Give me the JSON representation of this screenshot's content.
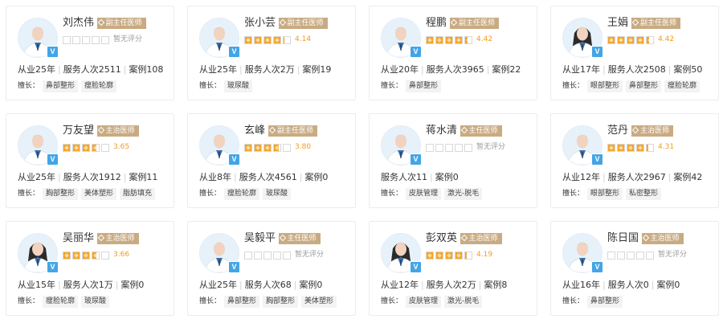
{
  "labels": {
    "verified": "V",
    "specialty_prefix": "擅长：",
    "no_rating": "暂无评分"
  },
  "doctors": [
    {
      "name": "刘杰伟",
      "title": "副主任医师",
      "rating": 0,
      "rating_text": "暂无评分",
      "years": "从业25年",
      "served": "服务人次2511",
      "cases": "案例108",
      "specialties": [
        "鼻部整形",
        "瘦脸轮廓"
      ]
    },
    {
      "name": "张小芸",
      "title": "副主任医师",
      "rating": 4.14,
      "rating_text": "4.14",
      "years": "从业25年",
      "served": "服务人次2万",
      "cases": "案例19",
      "specialties": [
        "玻尿酸"
      ]
    },
    {
      "name": "程鹏",
      "title": "副主任医师",
      "rating": 4.42,
      "rating_text": "4.42",
      "years": "从业20年",
      "served": "服务人次3965",
      "cases": "案例22",
      "specialties": [
        "鼻部整形"
      ]
    },
    {
      "name": "王娟",
      "title": "副主任医师",
      "rating": 4.42,
      "rating_text": "4.42",
      "years": "从业17年",
      "served": "服务人次2508",
      "cases": "案例50",
      "specialties": [
        "眼部整形",
        "鼻部整形",
        "瘦脸轮廓"
      ]
    },
    {
      "name": "万友望",
      "title": "主治医师",
      "rating": 3.65,
      "rating_text": "3.65",
      "years": "从业25年",
      "served": "服务人次1912",
      "cases": "案例11",
      "specialties": [
        "胸部整形",
        "美体塑形",
        "脂肪填充"
      ]
    },
    {
      "name": "玄峰",
      "title": "副主任医师",
      "rating": 3.8,
      "rating_text": "3.80",
      "years": "从业8年",
      "served": "服务人次4561",
      "cases": "案例0",
      "specialties": [
        "瘦脸轮廓",
        "玻尿酸"
      ]
    },
    {
      "name": "蒋水清",
      "title": "主任医师",
      "rating": 0,
      "rating_text": "暂无评分",
      "years": "",
      "served": "服务人次11",
      "cases": "案例0",
      "specialties": [
        "皮肤管理",
        "激光-脱毛"
      ]
    },
    {
      "name": "范丹",
      "title": "主治医师",
      "rating": 4.31,
      "rating_text": "4.31",
      "years": "从业12年",
      "served": "服务人次2967",
      "cases": "案例42",
      "specialties": [
        "眼部整形",
        "私密整形"
      ]
    },
    {
      "name": "吴丽华",
      "title": "主治医师",
      "rating": 3.66,
      "rating_text": "3.66",
      "years": "从业15年",
      "served": "服务人次1万",
      "cases": "案例0",
      "specialties": [
        "瘦脸轮廓",
        "玻尿酸"
      ]
    },
    {
      "name": "吴毅平",
      "title": "主任医师",
      "rating": 0,
      "rating_text": "暂无评分",
      "years": "从业25年",
      "served": "服务人次68",
      "cases": "案例0",
      "specialties": [
        "鼻部整形",
        "胸部整形",
        "美体塑形"
      ]
    },
    {
      "name": "彭双英",
      "title": "主治医师",
      "rating": 4.19,
      "rating_text": "4.19",
      "years": "从业12年",
      "served": "服务人次2万",
      "cases": "案例8",
      "specialties": [
        "皮肤管理",
        "激光-脱毛"
      ]
    },
    {
      "name": "陈日国",
      "title": "主治医师",
      "rating": 0,
      "rating_text": "暂无评分",
      "years": "从业16年",
      "served": "服务人次0",
      "cases": "案例0",
      "specialties": [
        "鼻部整形"
      ]
    }
  ],
  "colors": {
    "title_badge": "#c9ab83",
    "star": "#f5a524",
    "verified": "#43a5e6"
  }
}
